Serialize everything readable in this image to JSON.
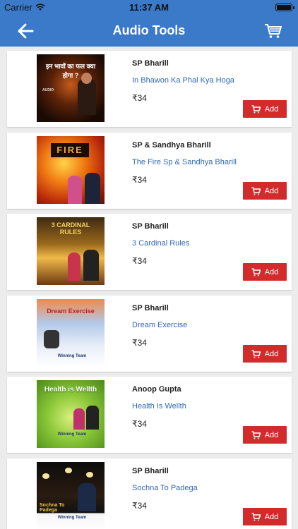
{
  "status_bar": {
    "carrier": "Carrier",
    "time": "11:37 AM"
  },
  "nav": {
    "title": "Audio Tools",
    "back_icon": "back-arrow-icon",
    "cart_icon": "cart-icon"
  },
  "colors": {
    "nav_bg": "#3b79c9",
    "add_button": "#d32b2b",
    "product_link": "#3168b3"
  },
  "items": [
    {
      "author": "SP Bharill",
      "name": "In Bhawon Ka Phal Kya Hoga",
      "price": "₹34",
      "add_label": "Add"
    },
    {
      "author": "SP & Sandhya Bharill",
      "name": "The Fire Sp & Sandhya Bharill",
      "price": "₹34",
      "add_label": "Add"
    },
    {
      "author": "SP Bharill",
      "name": "3 Cardinal Rules",
      "price": "₹34",
      "add_label": "Add"
    },
    {
      "author": "SP Bharill",
      "name": "Dream Exercise",
      "price": "₹34",
      "add_label": "Add"
    },
    {
      "author": "Anoop Gupta",
      "name": "Health Is Wellth",
      "price": "₹34",
      "add_label": "Add"
    },
    {
      "author": "SP Bharill",
      "name": "Sochna To Padega",
      "price": "₹34",
      "add_label": "Add"
    }
  ],
  "thumb_text": {
    "t1": "इन भावों का फल क्या होगा ?",
    "t2": "FIRE",
    "t3": "3 CARDINAL RULES",
    "t4": "Dream Exercise",
    "t5": "Health is Wellth",
    "t6": "Sochna To Padega",
    "winning_team": "Winning Team",
    "audio": "AUDIO"
  }
}
